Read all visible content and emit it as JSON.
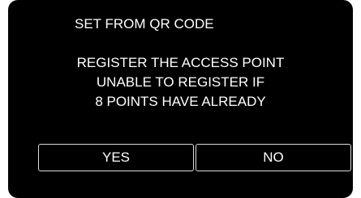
{
  "dialog": {
    "title": "SET FROM QR CODE",
    "message_lines": [
      "REGISTER THE ACCESS POINT",
      "UNABLE TO REGISTER IF",
      "8 POINTS HAVE ALREADY"
    ],
    "buttons": {
      "yes_label": "YES",
      "no_label": "NO"
    }
  },
  "colors": {
    "background": "#000000",
    "text": "#ffffff",
    "button_border": "#dcdcdc"
  }
}
